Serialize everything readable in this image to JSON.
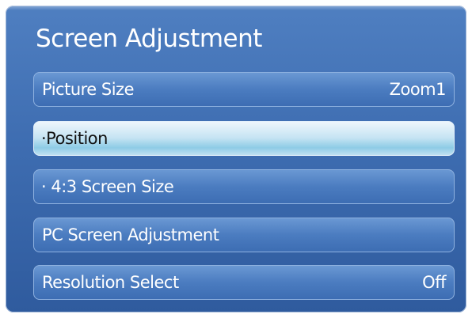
{
  "menu": {
    "title": "Screen Adjustment",
    "items": [
      {
        "label": "Picture Size",
        "value": "Zoom1"
      },
      {
        "label": "·Position",
        "value": ""
      },
      {
        "label": "· 4:3 Screen Size",
        "value": ""
      },
      {
        "label": "PC Screen Adjustment",
        "value": ""
      },
      {
        "label": "Resolution Select",
        "value": "Off"
      }
    ],
    "selected_index": 1
  },
  "colors": {
    "panel": "#3e6db1",
    "item": "#4b7cc0",
    "selected": "#bfe1f1"
  }
}
